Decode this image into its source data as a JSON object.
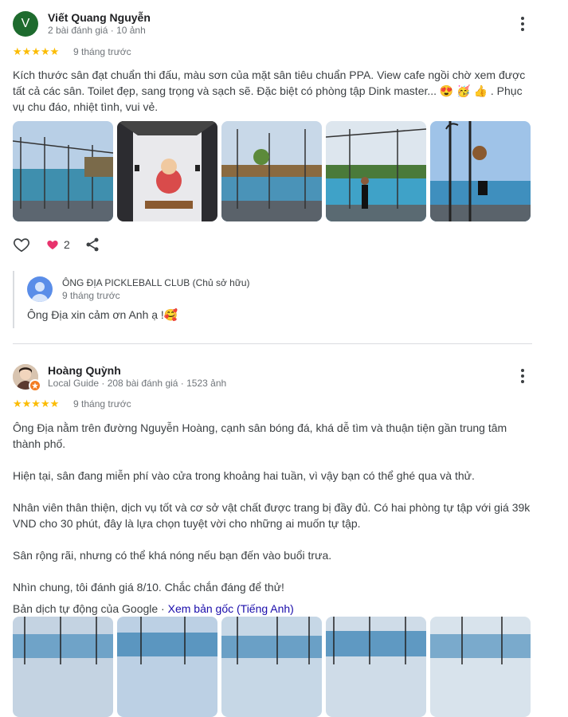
{
  "reviews": [
    {
      "avatar_letter": "V",
      "name": "Viết Quang Nguyễn",
      "meta": "2 bài đánh giá · 10 ảnh",
      "stars": "★★★★★",
      "when": "9 tháng trước",
      "text": "Kích thước sân đạt chuẩn thi đấu, màu sơn của mặt sân tiêu chuẩn PPA. View cafe ngồi chờ xem được tất cả các sân. Toilet đẹp, sang trọng và sạch sẽ. Đặc biệt có phòng tập Dink master... 😍 🥳 👍 . Phục vụ chu đáo, nhiệt tình, vui vẻ.",
      "reactions": {
        "count": "2"
      },
      "owner_reply": {
        "name": "ÔNG ĐỊA PICKLEBALL CLUB (Chủ sở hữu)",
        "when": "9 tháng trước",
        "text": "Ông Địa xin cảm ơn Anh ạ !🥰"
      }
    },
    {
      "name": "Hoàng Quỳnh",
      "meta": "Local Guide · 208 bài đánh giá · 1523 ảnh",
      "stars": "★★★★★",
      "when": "9 tháng trước",
      "paragraphs": [
        "Ông Địa nằm trên đường Nguyễn Hoàng, cạnh sân bóng đá, khá dễ tìm và thuận tiện gần trung tâm thành phố.",
        "Hiện tại, sân đang miễn phí vào cửa trong khoảng hai tuần, vì vậy bạn có thể ghé qua và thử.",
        "Nhân viên thân thiện, dịch vụ tốt và cơ sở vật chất được trang bị đầy đủ. Có hai phòng tự tập với giá 39k VND cho 30 phút, đây là lựa chọn tuyệt vời cho những ai muốn tự tập.",
        "Sân rộng rãi, nhưng có thể khá nóng nếu bạn đến vào buổi trưa.",
        "Nhìn chung, tôi đánh giá 8/10. Chắc chắn đáng để thử!"
      ],
      "translation_note": "Bản dịch tự động của Google ·",
      "translation_link": "Xem bản gốc (Tiếng Anh)"
    }
  ],
  "icons": {
    "like": "heart-outline-icon",
    "reaction": "heart-filled-icon",
    "share": "share-icon",
    "more": "more-vert-icon"
  },
  "colors": {
    "star": "#fbbc04",
    "reaction_heart": "#e8336d",
    "avatar_green": "#1e6b2e",
    "link": "#1a0dab",
    "owner_avatar": "#5a8de8"
  }
}
